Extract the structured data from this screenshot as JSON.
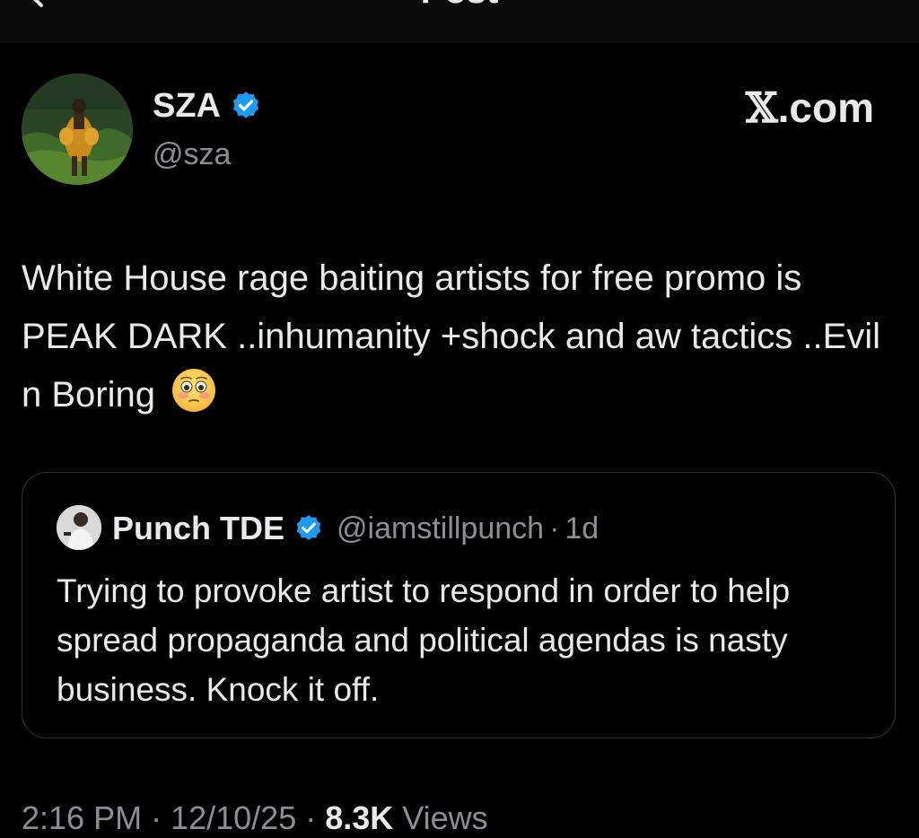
{
  "header": {
    "title": "Post"
  },
  "author": {
    "name": "SZA",
    "handle": "@sza",
    "verified": true
  },
  "watermark": {
    "x_mark": "𝕏",
    "domain": ".com"
  },
  "post": {
    "text": "White House rage baiting artists for free promo is PEAK DARK ..inhumanity +shock and aw tactics ..Evil n Boring",
    "emoji": "flushed-face"
  },
  "quote": {
    "name": "Punch TDE",
    "handle": "@iamstillpunch",
    "separator": "·",
    "time": "1d",
    "text": "Trying to provoke artist to respond in order to help spread propaganda and political agendas is nasty business. Knock it off.",
    "verified": true
  },
  "meta": {
    "time": "2:16 PM",
    "date": "12/10/25",
    "separator": " · ",
    "views_count": "8.3K",
    "views_label": "Views"
  },
  "colors": {
    "background": "#000000",
    "text": "#e7e9ea",
    "secondary_text": "#8b8f94",
    "verified_badge": "#1d9bf0",
    "border": "#2f3336"
  }
}
